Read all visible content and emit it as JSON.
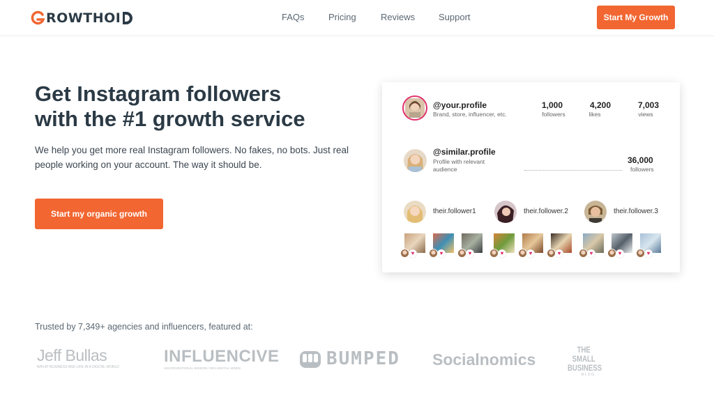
{
  "brand": {
    "logo_text": "ROWTHOI",
    "accent": "#f26631"
  },
  "nav": {
    "items": [
      "FAQs",
      "Pricing",
      "Reviews",
      "Support"
    ]
  },
  "header": {
    "cta_label": "Start My Growth"
  },
  "hero": {
    "title_line1": "Get Instagram followers",
    "title_line2": "with the #1 growth service",
    "subtitle": "We help you get more real Instagram followers. No fakes, no bots. Just real people working on your account.  The way it should be.",
    "cta_label": "Start my organic growth"
  },
  "card": {
    "your_profile": {
      "handle": "@your.profile",
      "desc": "Brand, store, influencer, etc.",
      "stats": [
        {
          "value": "1,000",
          "label": "followers"
        },
        {
          "value": "4,200",
          "label": "likes"
        },
        {
          "value": "7,003",
          "label": "views"
        }
      ]
    },
    "similar_profile": {
      "handle": "@similar.profile",
      "desc_line1": "Profile with relevant",
      "desc_line2": "audience",
      "followers_value": "36,000",
      "followers_label": "followers"
    },
    "followers": [
      "their.follower1",
      "their.follower.2",
      "their.follower.3"
    ]
  },
  "trusted": {
    "text": "Trusted by 7,349+ agencies and influencers, featured at:"
  },
  "press_logos": [
    "Jeff Bullas",
    "INFLUENCIVE",
    "BUMPED",
    "Socialnomics",
    "THE SMALL BUSINESS"
  ],
  "press_taglines": {
    "jeff": "WIN AT BUSINESS AND LIFE IN A DIGITAL WORLD",
    "influencive": "UNCONVENTIONAL WISDOM / INFLUENTIAL MINDS",
    "blog": "B L O G"
  }
}
